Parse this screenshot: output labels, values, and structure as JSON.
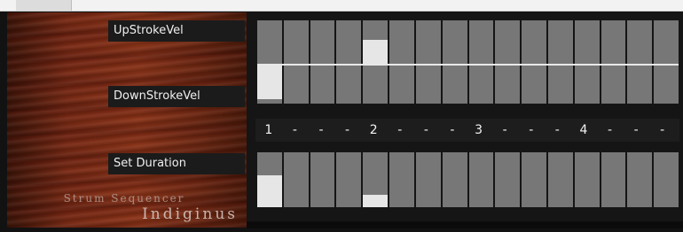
{
  "header": {
    "tab_label": ""
  },
  "labels": {
    "upstroke": "UpStrokeVel",
    "downstroke": "DownStrokeVel",
    "duration": "Set Duration"
  },
  "brand": {
    "line1": "Strum Sequencer",
    "line2": "Indiginus"
  },
  "beats": [
    "1",
    "-",
    "-",
    "-",
    "2",
    "-",
    "-",
    "-",
    "3",
    "-",
    "-",
    "-",
    "4",
    "-",
    "-",
    "-"
  ],
  "up_velocity_steps": [
    0,
    0,
    0,
    0,
    0.55,
    0,
    0,
    0,
    0,
    0,
    0,
    0,
    0,
    0,
    0,
    0
  ],
  "down_velocity_steps": [
    0.88,
    0,
    0,
    0,
    0,
    0,
    0,
    0,
    0,
    0,
    0,
    0,
    0,
    0,
    0,
    0
  ],
  "duration_steps": [
    0.58,
    0,
    0,
    0,
    0.22,
    0,
    0,
    0,
    0,
    0,
    0,
    0,
    0,
    0,
    0,
    0
  ]
}
